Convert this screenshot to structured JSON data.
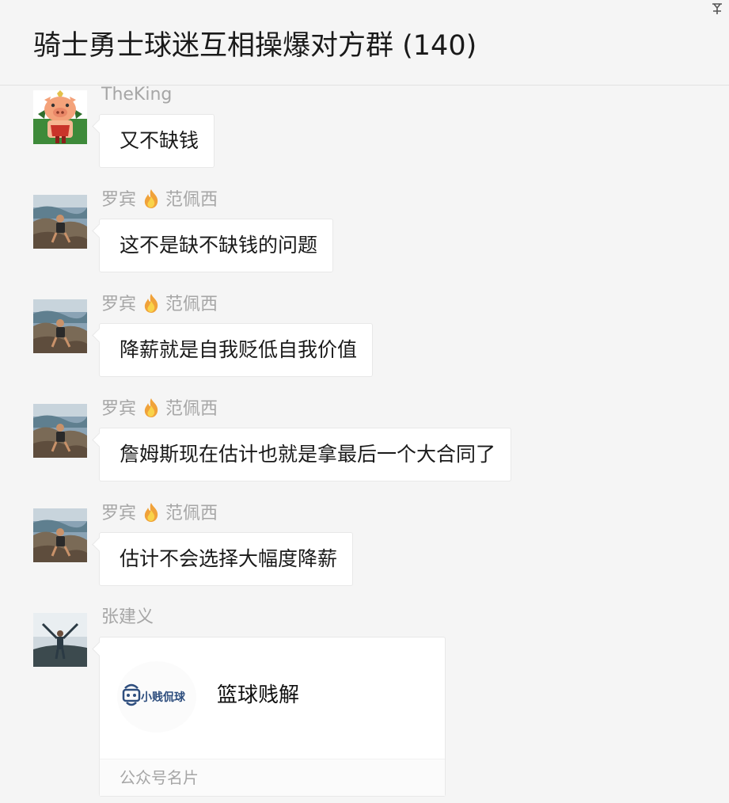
{
  "chat": {
    "title": "骑士勇士球迷互相操爆对方群 (140)",
    "pin_icon": "pin-icon"
  },
  "messages": [
    {
      "sender_name": "TheKing",
      "sender_suffix": "",
      "has_fire": false,
      "text": "又不缺钱",
      "avatar": "cartoon-avatar"
    },
    {
      "sender_name": "罗宾",
      "sender_suffix": "范佩西",
      "has_fire": true,
      "text": "这不是缺不缺钱的问题",
      "avatar": "photo-avatar"
    },
    {
      "sender_name": "罗宾",
      "sender_suffix": "范佩西",
      "has_fire": true,
      "text": "降薪就是自我贬低自我价值",
      "avatar": "photo-avatar"
    },
    {
      "sender_name": "罗宾",
      "sender_suffix": "范佩西",
      "has_fire": true,
      "text": "詹姆斯现在估计也就是拿最后一个大合同了",
      "avatar": "photo-avatar"
    },
    {
      "sender_name": "罗宾",
      "sender_suffix": "范佩西",
      "has_fire": true,
      "text": "估计不会选择大幅度降薪",
      "avatar": "photo-avatar"
    }
  ],
  "card_message": {
    "sender_name": "张建义",
    "avatar": "photo-avatar",
    "card_logo_text": "小贱侃球",
    "card_name": "篮球贱解",
    "card_type_label": "公众号名片"
  },
  "colors": {
    "background": "#f5f5f5",
    "bubble": "#ffffff",
    "sender_text": "#a6a6a6",
    "logo_blue": "#2e4e7e"
  }
}
